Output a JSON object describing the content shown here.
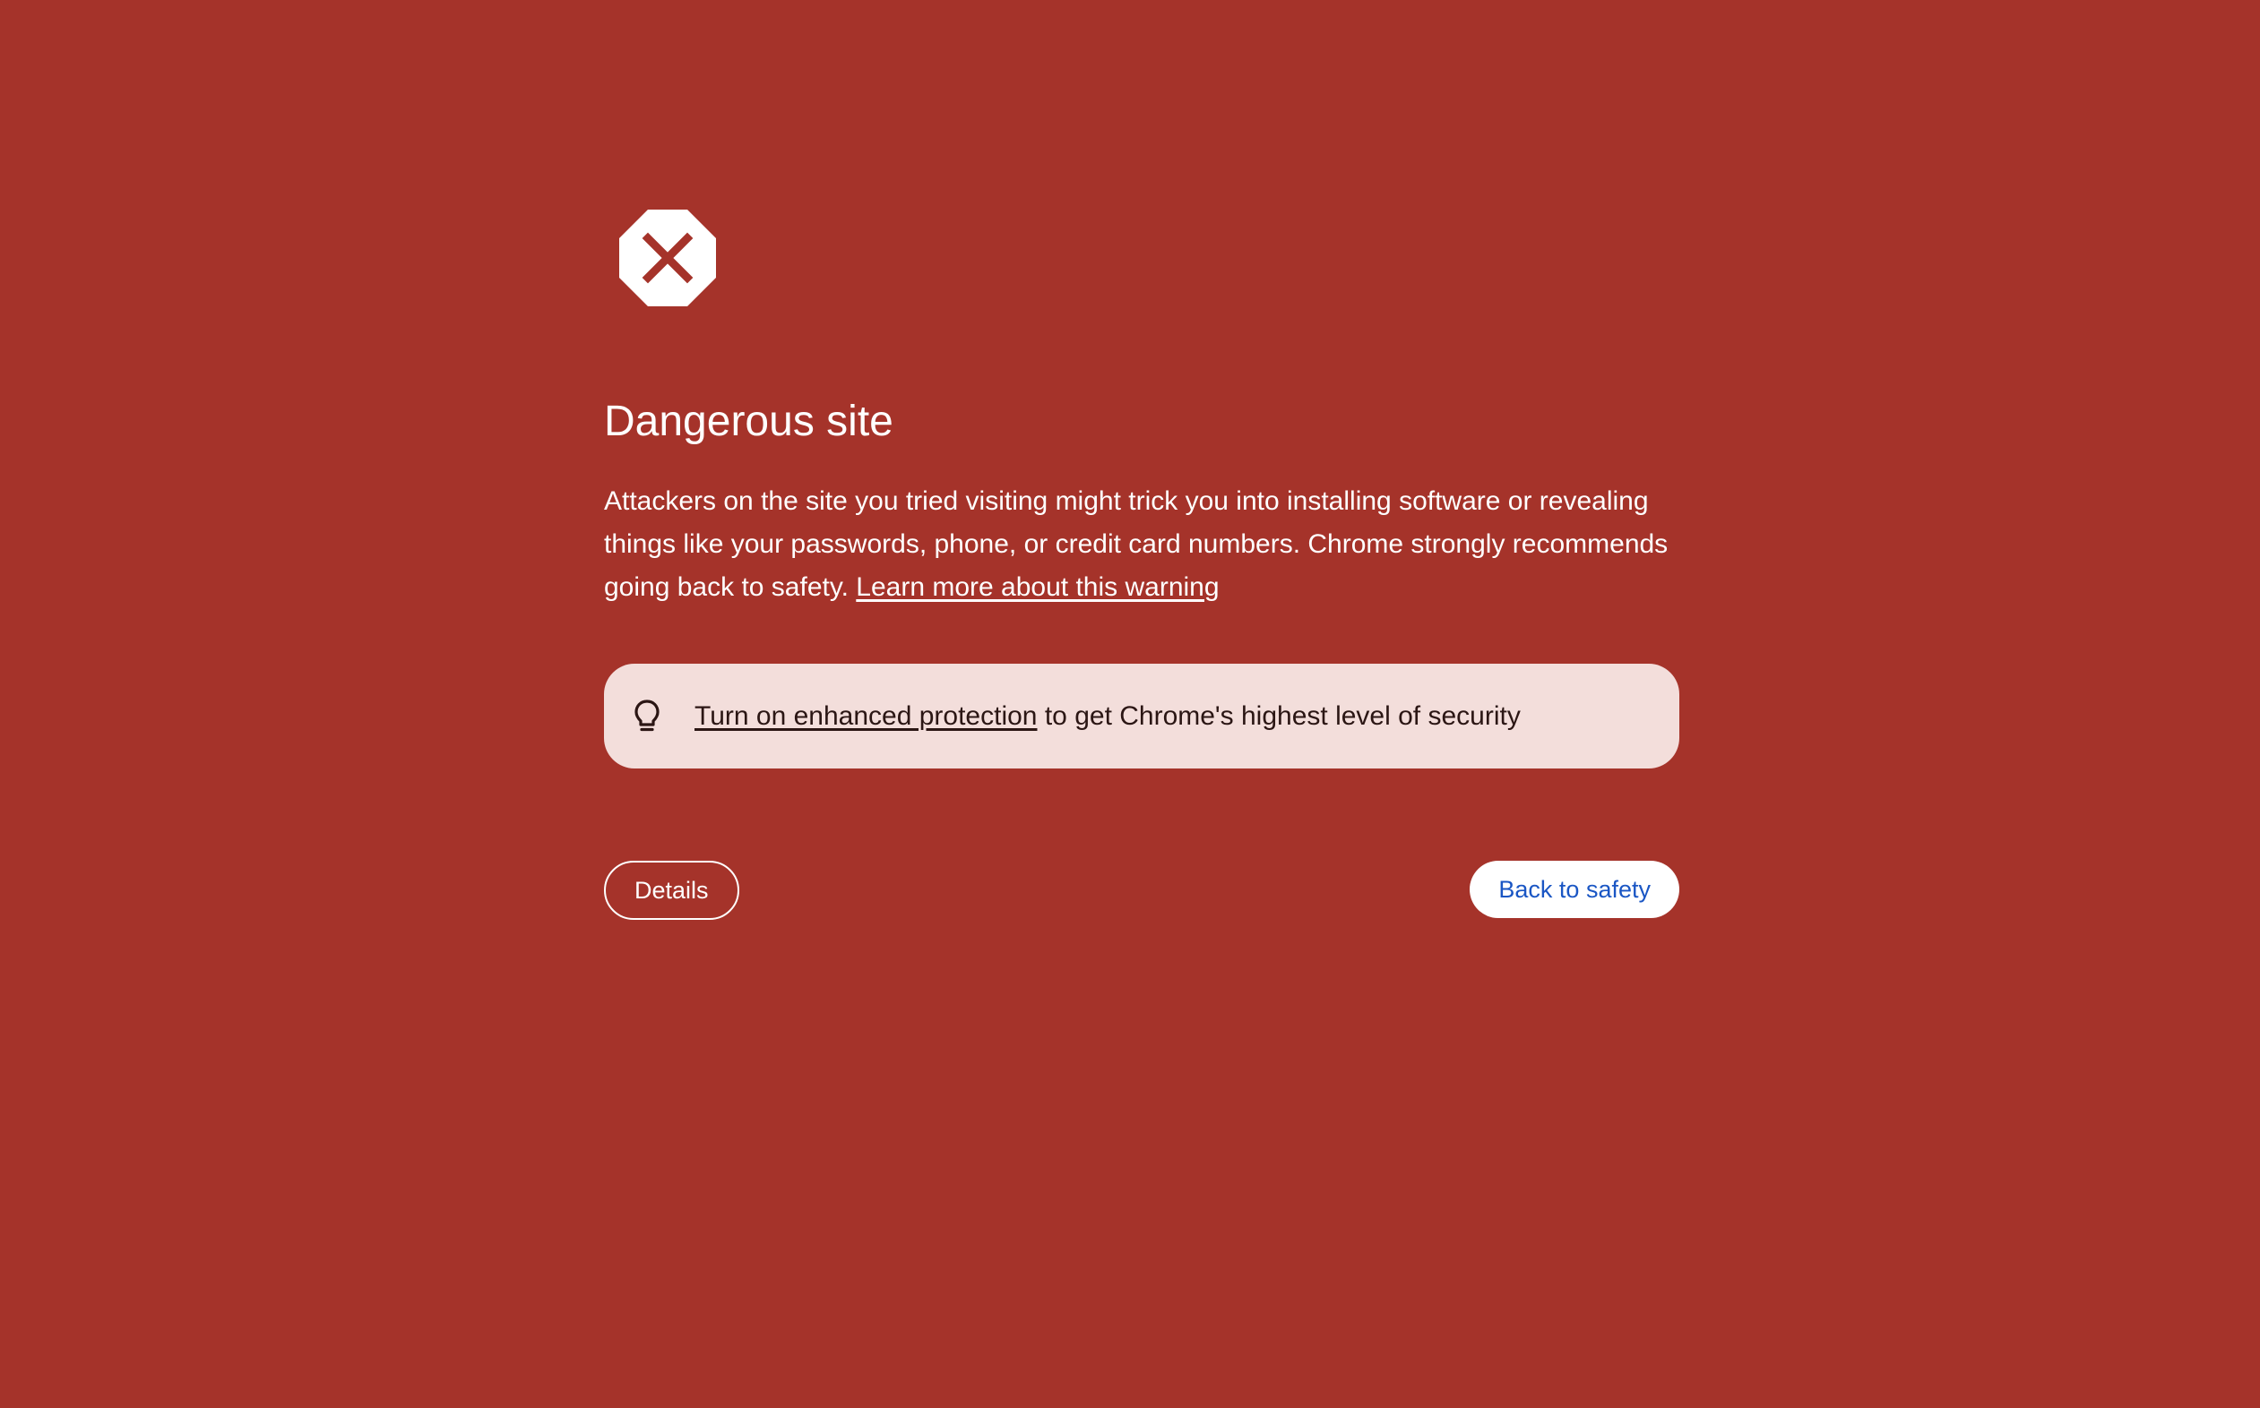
{
  "page": {
    "background_color": "#a5332a",
    "icon": "stop-x-icon"
  },
  "heading": "Dangerous site",
  "body": {
    "text": "Attackers on the site you tried visiting might trick you into installing software or revealing things like your passwords, phone, or credit card numbers. Chrome strongly recommends going back to safety.",
    "learn_more_link": "Learn more about this warning"
  },
  "tip": {
    "icon": "lightbulb-icon",
    "link_text": "Turn on enhanced protection",
    "text": "to get Chrome's highest level of security",
    "background_color": "#f3dedb"
  },
  "buttons": {
    "details_label": "Details",
    "back_label": "Back to safety",
    "back_text_color": "#1a56c4"
  }
}
